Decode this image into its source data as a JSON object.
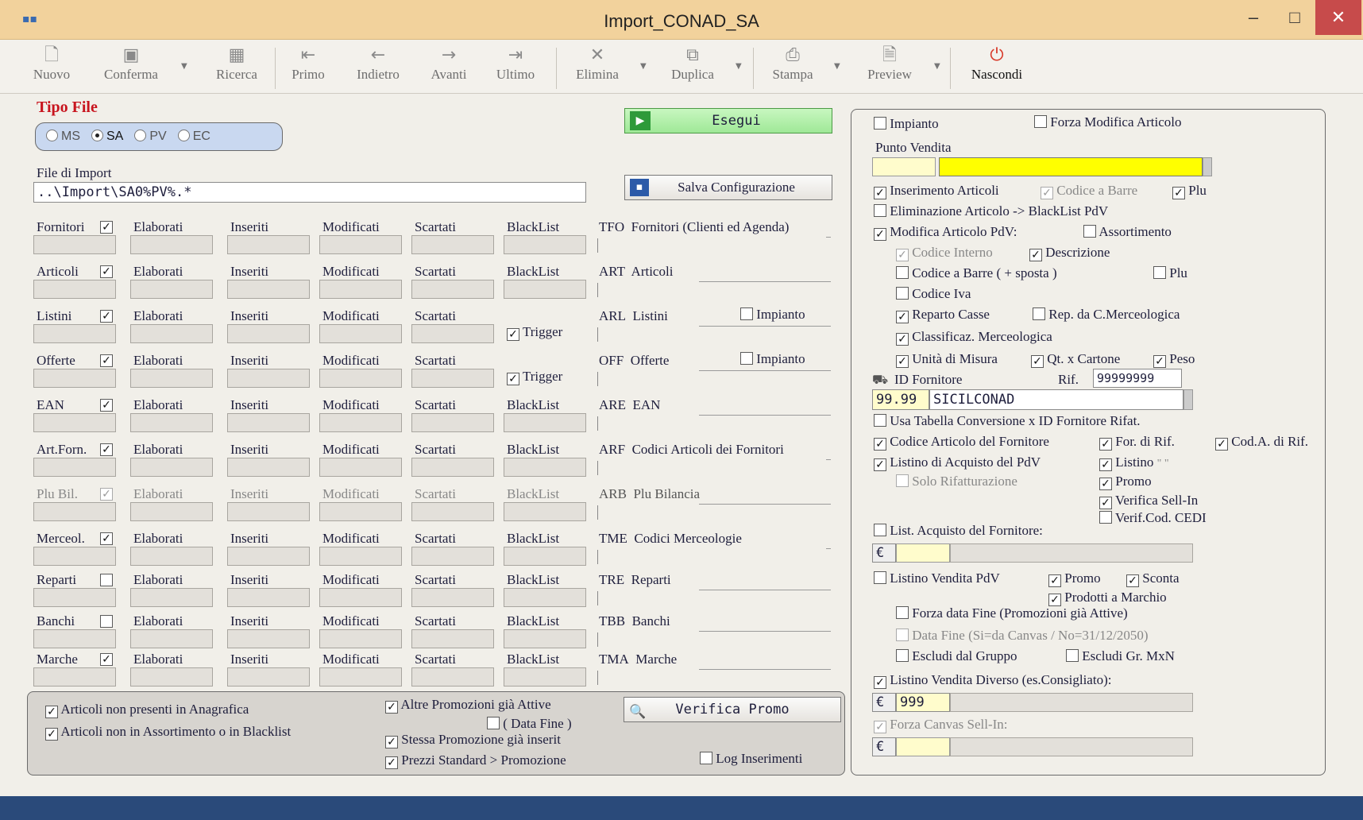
{
  "window": {
    "title": "Import_CONAD_SA",
    "minimize": "–",
    "maximize": "□",
    "close": "✕"
  },
  "toolbar": {
    "nuovo": "Nuovo",
    "conferma": "Conferma",
    "ricerca": "Ricerca",
    "primo": "Primo",
    "indietro": "Indietro",
    "avanti": "Avanti",
    "ultimo": "Ultimo",
    "elimina": "Elimina",
    "duplica": "Duplica",
    "stampa": "Stampa",
    "preview": "Preview",
    "nascondi": "Nascondi"
  },
  "tipo_file": {
    "label": "Tipo File",
    "options": [
      "MS",
      "SA",
      "PV",
      "EC"
    ],
    "selected": "SA"
  },
  "esegui": "Esegui",
  "salva": "Salva Configurazione",
  "file_import": {
    "label": "File di Import",
    "value": "..\\Import\\SA0%PV%.*"
  },
  "cols": {
    "elaborati": "Elaborati",
    "inseriti": "Inseriti",
    "modificati": "Modificati",
    "scartati": "Scartati",
    "blacklist": "BlackList"
  },
  "rows": [
    {
      "name": "Fornitori",
      "code": "TFO",
      "desc": "Fornitori (Clienti ed Agenda)",
      "checked": true
    },
    {
      "name": "Articoli",
      "code": "ART",
      "desc": "Articoli",
      "checked": true
    },
    {
      "name": "Listini",
      "code": "ARL",
      "desc": "Listini",
      "checked": true,
      "impianto": "Impianto",
      "trigger": "Trigger"
    },
    {
      "name": "Offerte",
      "code": "OFF",
      "desc": "Offerte",
      "checked": true,
      "impianto": "Impianto",
      "trigger": "Trigger"
    },
    {
      "name": "EAN",
      "code": "ARE",
      "desc": "EAN",
      "checked": true
    },
    {
      "name": "Art.Forn.",
      "code": "ARF",
      "desc": "Codici Articoli dei Fornitori",
      "checked": true
    },
    {
      "name": "Plu Bil.",
      "code": "ARB",
      "desc": "Plu Bilancia",
      "checked": true,
      "disabled": true
    },
    {
      "name": "Merceol.",
      "code": "TME",
      "desc": "Codici Merceologie",
      "checked": true
    },
    {
      "name": "Reparti",
      "code": "TRE",
      "desc": "Reparti",
      "checked": false
    },
    {
      "name": "Banchi",
      "code": "TBB",
      "desc": "Banchi",
      "checked": false
    },
    {
      "name": "Marche",
      "code": "TMA",
      "desc": "Marche",
      "checked": true
    }
  ],
  "bottom": {
    "art_non_pres": "Articoli non presenti in Anagrafica",
    "art_non_ass": "Articoli non in Assortimento o in Blacklist",
    "altre_promo": "Altre Promozioni già Attive",
    "data_fine": "( Data Fine )",
    "stessa_promo": "Stessa Promozione già inserit",
    "prezzi_std": "Prezzi Standard > Promozione",
    "verifica_promo": "Verifica Promo",
    "log_ins": "Log Inserimenti"
  },
  "right": {
    "impianto": "Impianto",
    "forza_mod": "Forza Modifica Articolo",
    "punto_vendita": "Punto Vendita",
    "ins_art": "Inserimento Articoli",
    "cod_barre": "Codice a Barre",
    "plu": "Plu",
    "elim_art": "Eliminazione Articolo -> BlackList PdV",
    "mod_art": "Modifica Articolo PdV:",
    "assortimento": "Assortimento",
    "cod_interno": "Codice Interno",
    "descrizione": "Descrizione",
    "cod_barre_sposta": "Codice a Barre ( + sposta )",
    "plu2": "Plu",
    "cod_iva": "Codice Iva",
    "reparto_casse": "Reparto Casse",
    "rep_merc": "Rep. da C.Merceologica",
    "classif": "Classificaz. Merceologica",
    "unita": "Unità di Misura",
    "qt_cartone": "Qt. x Cartone",
    "peso": "Peso",
    "id_fornitore": "ID Fornitore",
    "rif": "Rif.",
    "rif_value": "99999999",
    "forn_code": "99.99",
    "forn_name": "SICILCONAD",
    "usa_tab": "Usa Tabella Conversione x ID Fornitore Rifat.",
    "cod_art_forn": "Codice Articolo del Fornitore",
    "for_rif": "For. di Rif.",
    "cod_rif": "Cod.A. di Rif.",
    "listino_acq": "Listino di Acquisto del PdV",
    "listino": "Listino",
    "listino_quote": "\" \"",
    "solo_rifatt": "Solo Rifatturazione",
    "promo": "Promo",
    "verifica_sell": "Verifica Sell-In",
    "verif_cedi": "Verif.Cod. CEDI",
    "list_acq_forn": "List. Acquisto del Fornitore:",
    "euro": "€",
    "listino_vend": "Listino Vendita PdV",
    "promo2": "Promo",
    "sconta": "Sconta",
    "prod_marchio": "Prodotti a Marchio",
    "forza_data": "Forza data Fine (Promozioni già Attive)",
    "data_fine2": "Data Fine (Si=da Canvas / No=31/12/2050)",
    "escludi_gruppo": "Escludi dal Gruppo",
    "escludi_mxn": "Escludi Gr. MxN",
    "listino_diverso": "Listino Vendita Diverso (es.Consigliato):",
    "diverso_value": "999",
    "forza_canvas": "Forza Canvas Sell-In:"
  }
}
